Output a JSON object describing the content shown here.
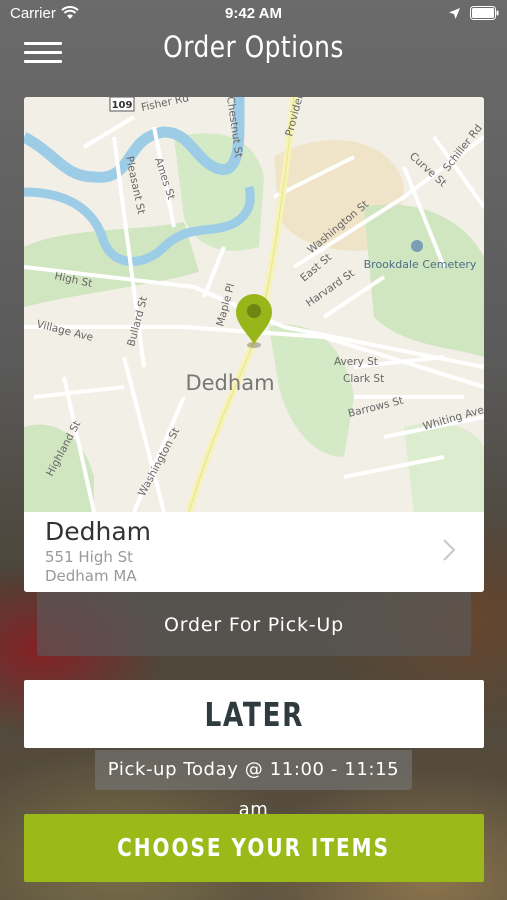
{
  "status_bar": {
    "carrier": "Carrier",
    "time": "9:42 AM",
    "icons": [
      "wifi-icon",
      "location-arrow-icon",
      "battery-icon"
    ]
  },
  "nav": {
    "title": "Order Options",
    "menu_icon": "hamburger-menu-icon"
  },
  "map": {
    "town_label": "Dedham",
    "route_shield": "109",
    "streets": [
      "Fisher Rd",
      "Providence",
      "Ames St",
      "Pleasant St",
      "Washington St",
      "Curve St",
      "Schiller Rd",
      "High St",
      "East St",
      "Harvard St",
      "Maple Pl",
      "Bullard St",
      "Village Ave",
      "Avery St",
      "Clark St",
      "Barrows St",
      "Whiting Ave",
      "Highland St",
      "Washington St",
      "Chestnut St"
    ],
    "poi": "Brookdale Cemetery",
    "colors": {
      "land": "#f2efe6",
      "park": "#cfe6c0",
      "water": "#9dcde6",
      "road": "#ffffff",
      "major_road": "#f6f3b4",
      "pin": "#98b51a"
    }
  },
  "location": {
    "name": "Dedham",
    "address_line1": "551 High St",
    "address_line2": "Dedham MA"
  },
  "order_type": {
    "label": "Order For Pick-Up"
  },
  "time_option": {
    "label": "LATER"
  },
  "pickup_time": {
    "text": "Pick-up Today @ 11:00 - 11:15 am"
  },
  "cta": {
    "label": "CHOOSE YOUR ITEMS",
    "color": "#9bba1a"
  }
}
